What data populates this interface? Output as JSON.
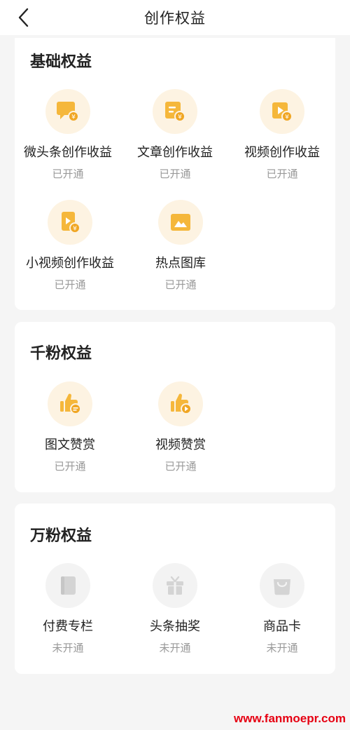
{
  "header": {
    "title": "创作权益"
  },
  "sections": {
    "basic": {
      "title": "基础权益",
      "items": [
        {
          "label": "微头条创作收益",
          "status": "已开通",
          "icon": "chat-bubble-yuan-icon"
        },
        {
          "label": "文章创作收益",
          "status": "已开通",
          "icon": "document-yuan-icon"
        },
        {
          "label": "视频创作收益",
          "status": "已开通",
          "icon": "video-yuan-icon"
        },
        {
          "label": "小视频创作收益",
          "status": "已开通",
          "icon": "short-video-yuan-icon"
        },
        {
          "label": "热点图库",
          "status": "已开通",
          "icon": "image-gallery-icon"
        }
      ]
    },
    "thousand": {
      "title": "千粉权益",
      "items": [
        {
          "label": "图文赞赏",
          "status": "已开通",
          "icon": "thumbs-up-doc-icon"
        },
        {
          "label": "视频赞赏",
          "status": "已开通",
          "icon": "thumbs-up-play-icon"
        }
      ]
    },
    "tenthousand": {
      "title": "万粉权益",
      "items": [
        {
          "label": "付费专栏",
          "status": "未开通",
          "icon": "book-icon"
        },
        {
          "label": "头条抽奖",
          "status": "未开通",
          "icon": "gift-box-icon"
        },
        {
          "label": "商品卡",
          "status": "未开通",
          "icon": "shopping-bag-icon"
        }
      ]
    }
  },
  "watermark": "www.fanmoepr.com",
  "colors": {
    "accent": "#f5b73b",
    "accent_light": "#fdf3e2",
    "disabled": "#d4d4d4"
  }
}
